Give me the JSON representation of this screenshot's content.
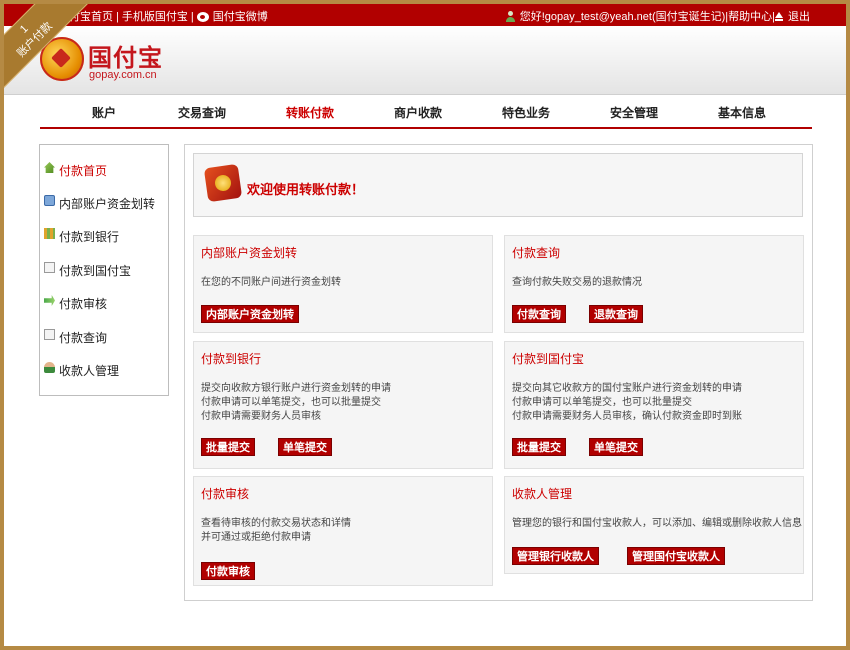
{
  "ribbon": {
    "number": "1",
    "label": "账户付款"
  },
  "topbar": {
    "links": [
      "国付宝首页",
      "手机版国付宝",
      "国付宝微博"
    ],
    "separator": "|",
    "greeting": "您好!gopay_test@yeah.net(国付宝诞生记)",
    "help": "帮助中心",
    "logout": "退出"
  },
  "logo": {
    "name": "国付宝",
    "domain": "gopay.com.cn"
  },
  "nav": {
    "items": [
      "账户",
      "交易查询",
      "转账付款",
      "商户收款",
      "特色业务",
      "安全管理",
      "基本信息"
    ],
    "active": "转账付款"
  },
  "sidebar": {
    "items": [
      {
        "label": "付款首页",
        "icon": "home-icon"
      },
      {
        "label": "内部账户资金划转",
        "icon": "transfer-icon"
      },
      {
        "label": "付款到银行",
        "icon": "bank-icon"
      },
      {
        "label": "付款到国付宝",
        "icon": "document-icon"
      },
      {
        "label": "付款审核",
        "icon": "audit-icon"
      },
      {
        "label": "付款查询",
        "icon": "document-icon"
      },
      {
        "label": "收款人管理",
        "icon": "user-icon"
      }
    ]
  },
  "welcome": {
    "text": "欢迎使用转账付款！"
  },
  "cards": [
    {
      "title": "内部账户资金划转",
      "desc": [
        "在您的不同账户间进行资金划转"
      ],
      "buttons": [
        "内部账户资金划转"
      ]
    },
    {
      "title": "付款查询",
      "desc": [
        "查询付款失败交易的退款情况"
      ],
      "buttons": [
        "付款查询",
        "退款查询"
      ]
    },
    {
      "title": "付款到银行",
      "desc": [
        "提交向收款方银行账户进行资金划转的申请",
        "付款申请可以单笔提交，也可以批量提交",
        "付款申请需要财务人员审核"
      ],
      "buttons": [
        "批量提交",
        "单笔提交"
      ]
    },
    {
      "title": "付款到国付宝",
      "desc": [
        "提交向其它收款方的国付宝账户进行资金划转的申请",
        "付款申请可以单笔提交，也可以批量提交",
        "付款申请需要财务人员审核，确认付款资金即时到账"
      ],
      "buttons": [
        "批量提交",
        "单笔提交"
      ]
    },
    {
      "title": "付款审核",
      "desc": [
        "查看待审核的付款交易状态和详情",
        "并可通过或拒绝付款申请"
      ],
      "buttons": [
        "付款审核"
      ]
    },
    {
      "title": "收款人管理",
      "desc": [
        "管理您的银行和国付宝收款人，可以添加、编辑或删除收款人信息"
      ],
      "buttons": [
        "管理银行收款人",
        "管理国付宝收款人"
      ]
    }
  ],
  "colors": {
    "brand_red": "#b10000",
    "accent_red": "#cc0000",
    "frame_gold": "#b58a44"
  }
}
